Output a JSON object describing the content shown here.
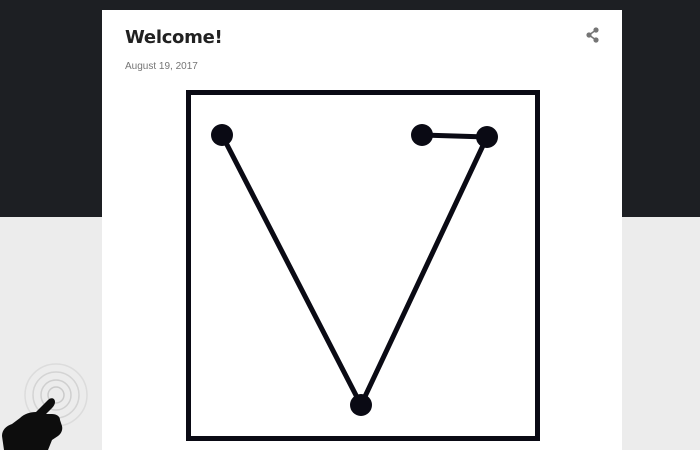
{
  "post": {
    "title": "Welcome!",
    "date": "August 19, 2017"
  },
  "icons": {
    "share": "share-icon",
    "tap": "hand-tap-icon"
  },
  "colors": {
    "header_bg": "#1d1f23",
    "page_bg": "#ececec",
    "card_bg": "#ffffff",
    "title": "#212121",
    "date": "#757575",
    "pattern": "#0a0a14"
  }
}
